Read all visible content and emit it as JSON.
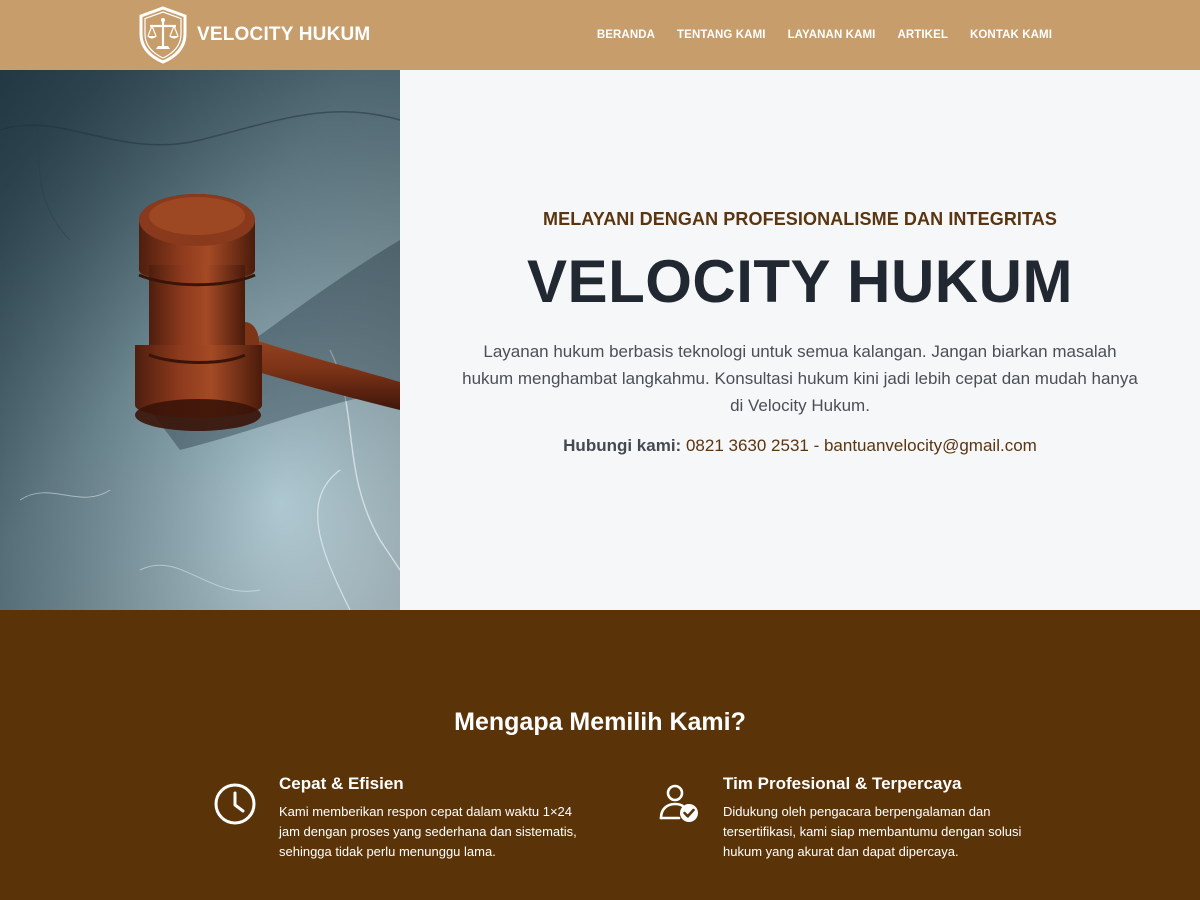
{
  "header": {
    "brand": "VELOCITY HUKUM",
    "logo_icon": "scales-of-justice-shield-icon",
    "nav": [
      {
        "label": "BERANDA"
      },
      {
        "label": "TENTANG KAMI"
      },
      {
        "label": "LAYANAN KAMI"
      },
      {
        "label": "ARTIKEL"
      },
      {
        "label": "KONTAK KAMI"
      }
    ]
  },
  "hero": {
    "image": "judge-gavel-photo",
    "tagline": "MELAYANI DENGAN PROFESIONALISME DAN INTEGRITAS",
    "title": "VELOCITY HUKUM",
    "description": "Layanan hukum berbasis teknologi untuk semua kalangan. Jangan biarkan masalah hukum menghambat langkahmu. Konsultasi hukum kini jadi lebih cepat dan mudah hanya di Velocity Hukum.",
    "contact_label": "Hubungi kami:",
    "contact_value": "0821 3630 2531 - bantuanvelocity@gmail.com"
  },
  "why": {
    "title": "Mengapa Memilih Kami?",
    "features": [
      {
        "icon": "clock-icon",
        "title": "Cepat & Efisien",
        "text": "Kami memberikan respon cepat dalam waktu 1×24 jam dengan proses yang sederhana dan sistematis, sehingga tidak perlu menunggu lama."
      },
      {
        "icon": "user-check-icon",
        "title": "Tim Profesional & Terpercaya",
        "text": "Didukung oleh pengacara berpengalaman dan tersertifikasi, kami siap membantumu dengan solusi hukum yang akurat dan dapat dipercaya."
      }
    ]
  },
  "colors": {
    "header_bg": "#C79D6B",
    "brand_brown": "#5A3510",
    "section_brown": "#5A3308",
    "hero_bg": "#F6F7F9",
    "title_dark": "#222831"
  }
}
